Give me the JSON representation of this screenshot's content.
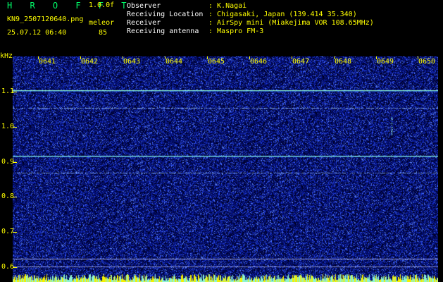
{
  "header": {
    "brand": "H R O F F T",
    "version": "1.0.0f",
    "filename": "KN9_2507120640.png",
    "station": "meleor",
    "datetime": "25.07.12 06:40",
    "count": "85"
  },
  "meta": [
    {
      "label": "Observer",
      "value": ": K.Nagai"
    },
    {
      "label": "Receiving Location",
      "value": ": Chigasaki, Japan (139.414 35.340)"
    },
    {
      "label": "Receiver",
      "value": ": AirSpy mini (Miakejima VOR 108.65MHz)"
    },
    {
      "label": "Receiving antenna",
      "value": ": Maspro FM-3"
    }
  ],
  "spectrogram": {
    "y_unit": "kHz",
    "y_labels": [
      "1.1",
      "1.0",
      "0.9",
      "0.8",
      "0.7",
      "0.6"
    ],
    "x_labels": [
      "0641",
      "0642",
      "0643",
      "0644",
      "0645",
      "0646",
      "0647",
      "0648",
      "0649",
      "0650"
    ],
    "colors": {
      "label": "#ffff00",
      "line": "#00ffd0",
      "noise_dark": "#000035",
      "noise_bright": "#3050ff"
    }
  }
}
